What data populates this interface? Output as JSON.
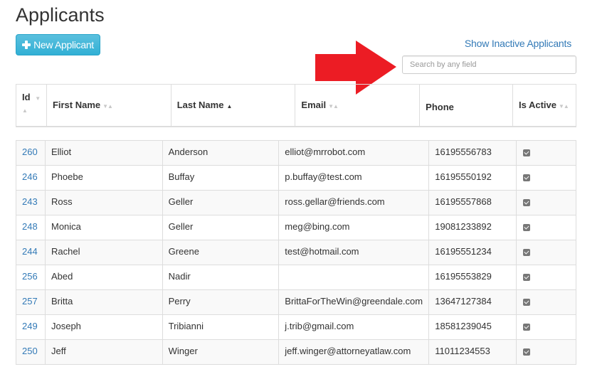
{
  "page": {
    "title": "Applicants"
  },
  "toolbar": {
    "new_button_label": "New Applicant",
    "new_button_icon": "plus-icon",
    "show_inactive_label": "Show Inactive Applicants",
    "search_placeholder": "Search by any field",
    "search_value": ""
  },
  "annotation": {
    "arrow_icon": "red-arrow-right-icon",
    "arrow_color": "#ec1c24"
  },
  "colors": {
    "primary_button": "#5bc0de",
    "link": "#337ab7",
    "border": "#dddddd",
    "stripe": "#f9f9f9"
  },
  "table": {
    "columns": [
      {
        "label": "Id",
        "sort": "sortable"
      },
      {
        "label": "First Name",
        "sort": "sortable"
      },
      {
        "label": "Last Name",
        "sort": "ascending"
      },
      {
        "label": "Email",
        "sort": "sortable"
      },
      {
        "label": "Phone",
        "sort": "none"
      },
      {
        "label": "Is Active",
        "sort": "sortable"
      }
    ],
    "sort_glyphs": {
      "sortable": "▼▲",
      "ascending": "▲",
      "down": "▼",
      "up": "▲"
    },
    "rows": [
      {
        "id": "260",
        "first_name": "Elliot",
        "last_name": "Anderson",
        "email": "elliot@mrrobot.com",
        "phone": "16195556783",
        "is_active": true
      },
      {
        "id": "246",
        "first_name": "Phoebe",
        "last_name": "Buffay",
        "email": "p.buffay@test.com",
        "phone": "16195550192",
        "is_active": true
      },
      {
        "id": "243",
        "first_name": "Ross",
        "last_name": "Geller",
        "email": "ross.gellar@friends.com",
        "phone": "16195557868",
        "is_active": true
      },
      {
        "id": "248",
        "first_name": "Monica",
        "last_name": "Geller",
        "email": "meg@bing.com",
        "phone": "19081233892",
        "is_active": true
      },
      {
        "id": "244",
        "first_name": "Rachel",
        "last_name": "Greene",
        "email": "test@hotmail.com",
        "phone": "16195551234",
        "is_active": true
      },
      {
        "id": "256",
        "first_name": "Abed",
        "last_name": "Nadir",
        "email": "",
        "phone": "16195553829",
        "is_active": true
      },
      {
        "id": "257",
        "first_name": "Britta",
        "last_name": "Perry",
        "email": "BrittaForTheWin@greendale.com",
        "phone": "13647127384",
        "is_active": true
      },
      {
        "id": "249",
        "first_name": "Joseph",
        "last_name": "Tribianni",
        "email": "j.trib@gmail.com",
        "phone": "18581239045",
        "is_active": true
      },
      {
        "id": "250",
        "first_name": "Jeff",
        "last_name": "Winger",
        "email": "jeff.winger@attorneyatlaw.com",
        "phone": "11011234553",
        "is_active": true
      }
    ]
  }
}
